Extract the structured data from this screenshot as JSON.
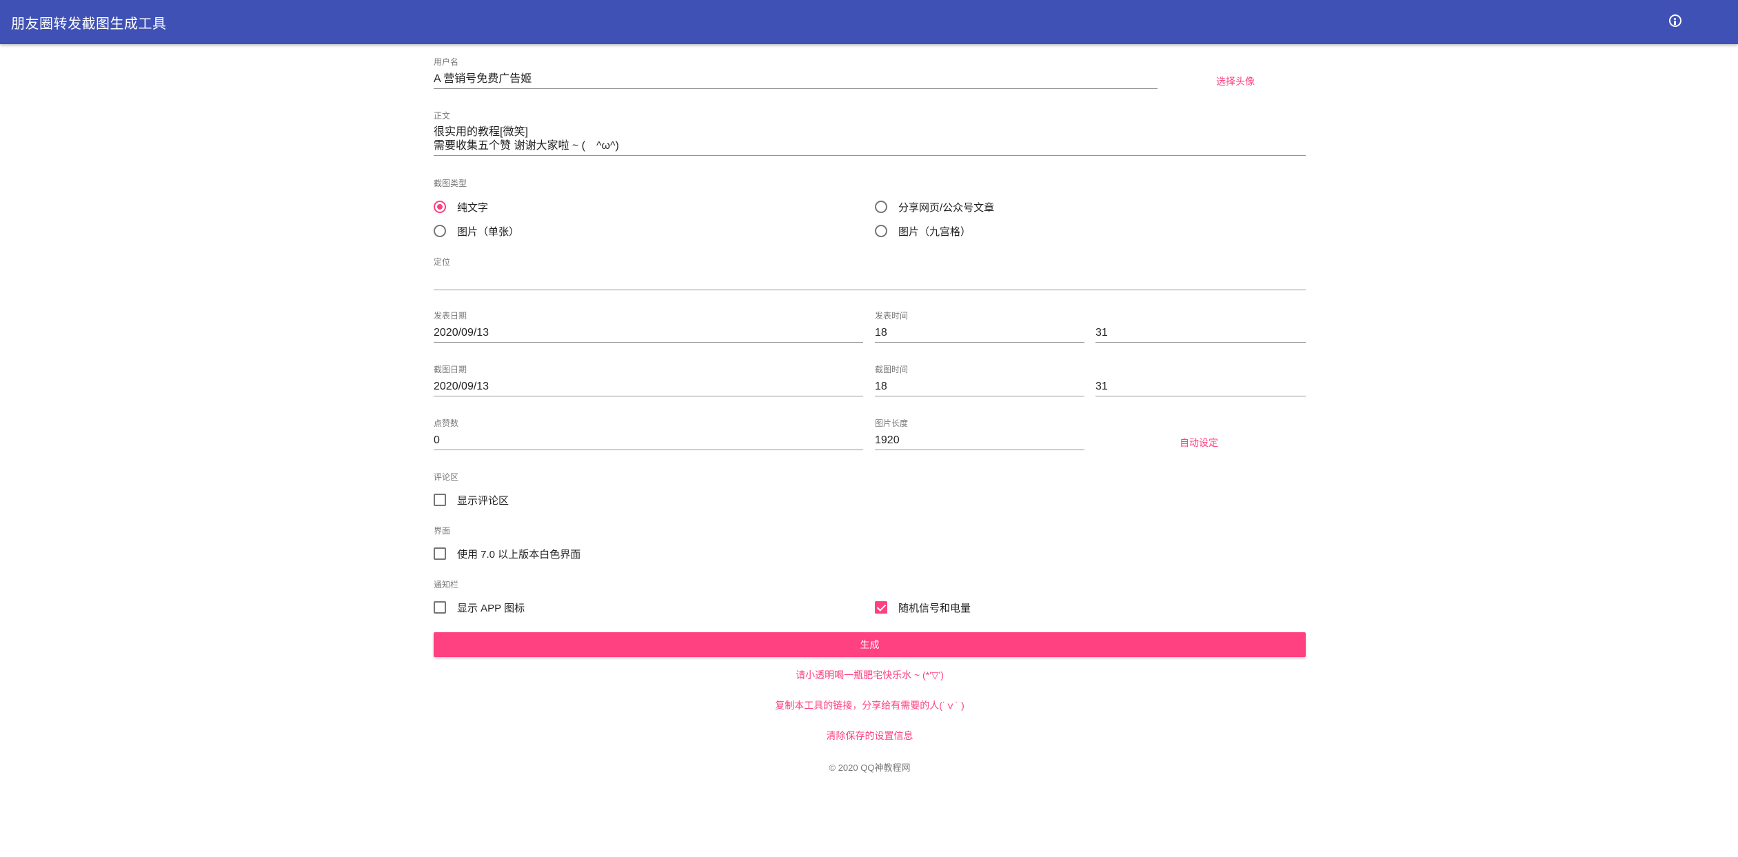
{
  "appbar": {
    "title": "朋友圈转发截图生成工具",
    "info_icon": "info-icon"
  },
  "username": {
    "label": "用户名",
    "value": "A 营销号免费广告姬",
    "avatar_button": "选择头像"
  },
  "body_text": {
    "label": "正文",
    "line1": "很实用的教程[微笑]",
    "line2": "需要收集五个赞 谢谢大家啦 ~ (　^ω^)"
  },
  "screenshot_type": {
    "label": "截图类型",
    "options": [
      {
        "label": "纯文字",
        "selected": true
      },
      {
        "label": "分享网页/公众号文章",
        "selected": false
      },
      {
        "label": "图片（单张）",
        "selected": false
      },
      {
        "label": "图片（九宫格）",
        "selected": false
      }
    ]
  },
  "location": {
    "label": "定位",
    "value": ""
  },
  "post": {
    "date_label": "发表日期",
    "date": "2020/09/13",
    "time_label": "发表时间",
    "hour": "18",
    "minute": "31"
  },
  "capture": {
    "date_label": "截图日期",
    "date": "2020/09/13",
    "time_label": "截图时间",
    "hour": "18",
    "minute": "31"
  },
  "likes": {
    "label": "点赞数",
    "value": "0"
  },
  "image_length": {
    "label": "图片长度",
    "value": "1920",
    "auto_button": "自动设定"
  },
  "comments": {
    "label": "评论区",
    "checkbox_label": "显示评论区",
    "checked": false
  },
  "interface": {
    "label": "界面",
    "checkbox_label": "使用 7.0 以上版本白色界面",
    "checked": false
  },
  "statusbar": {
    "label": "通知栏",
    "app_icon_label": "显示 APP 图标",
    "app_icon_checked": false,
    "random_label": "随机信号和电量",
    "random_checked": true
  },
  "generate_button": "生成",
  "links": {
    "donate": "请小透明喝一瓶肥宅快乐水 ~ (*'▽')",
    "share": "复制本工具的链接，分享给有需要的人(˙ｖ˙ )",
    "clear": "清除保存的设置信息"
  },
  "footer": "© 2020 QQ神教程网",
  "colors": {
    "primary": "#3f51b5",
    "accent": "#ff4081"
  }
}
